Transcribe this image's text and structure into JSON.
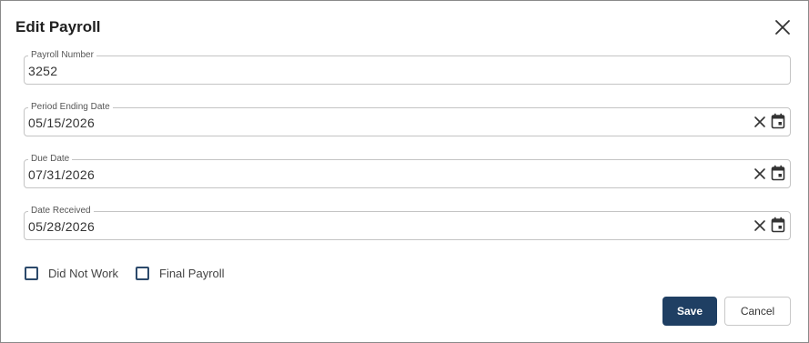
{
  "dialog": {
    "title": "Edit Payroll",
    "fields": [
      {
        "label": "Payroll Number",
        "value": "3252"
      },
      {
        "label": "Period Ending Date",
        "value": "05/15/2026"
      },
      {
        "label": "Due Date",
        "value": "07/31/2026"
      },
      {
        "label": "Date Received",
        "value": "05/28/2026"
      }
    ],
    "checkboxes": [
      {
        "label": "Did Not Work",
        "checked": false
      },
      {
        "label": "Final Payroll",
        "checked": false
      }
    ],
    "buttons": {
      "save": "Save",
      "cancel": "Cancel"
    },
    "icons": {
      "close": "close-icon",
      "clear": "clear-icon",
      "calendar": "calendar-icon"
    },
    "colors": {
      "primary": "#1f3f63",
      "checkbox_border": "#2c4a6b",
      "field_border": "#c4c4c4"
    }
  }
}
